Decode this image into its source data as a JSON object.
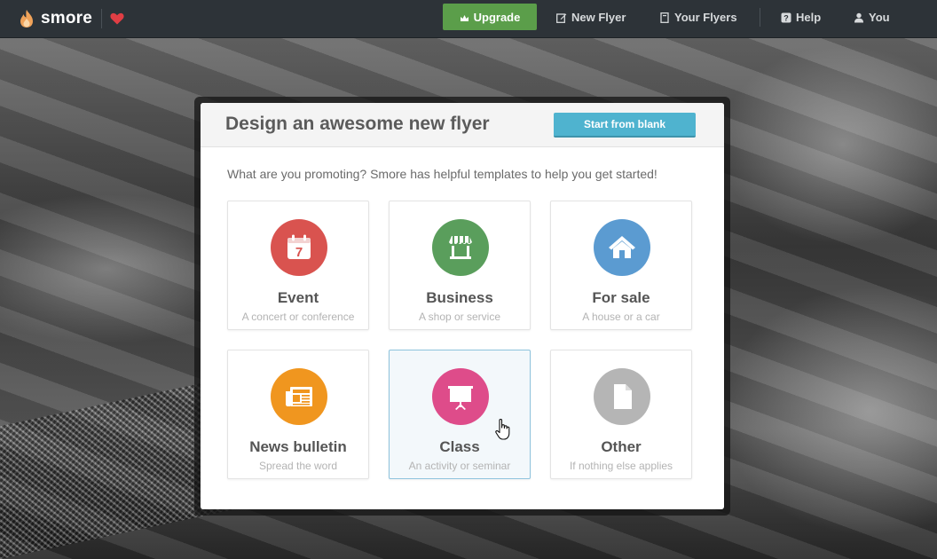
{
  "topbar": {
    "brand": "smore",
    "nav": {
      "upgrade": "Upgrade",
      "new_flyer": "New Flyer",
      "your_flyers": "Your Flyers",
      "help": "Help",
      "you": "You"
    }
  },
  "modal": {
    "title": "Design an awesome new flyer",
    "start_blank": "Start from blank",
    "prompt": "What are you promoting? Smore has helpful templates to help you get started!",
    "templates": [
      {
        "label": "Event",
        "sub": "A concert or conference",
        "color": "#d9534f",
        "icon": "calendar-icon"
      },
      {
        "label": "Business",
        "sub": "A shop or service",
        "color": "#5a9e5c",
        "icon": "storefront-icon"
      },
      {
        "label": "For sale",
        "sub": "A house or a car",
        "color": "#5b9bd1",
        "icon": "house-icon"
      },
      {
        "label": "News bulletin",
        "sub": "Spread the word",
        "color": "#f0961f",
        "icon": "newspaper-icon"
      },
      {
        "label": "Class",
        "sub": "An activity or seminar",
        "color": "#de4c8a",
        "icon": "presentation-board-icon"
      },
      {
        "label": "Other",
        "sub": "If nothing else applies",
        "color": "#b5b5b5",
        "icon": "document-icon"
      }
    ],
    "calendar_day": "7"
  },
  "colors": {
    "topbar_bg": "#2d3338",
    "upgrade_green": "#5b9e4a",
    "start_blank_blue": "#4fb3cf"
  }
}
